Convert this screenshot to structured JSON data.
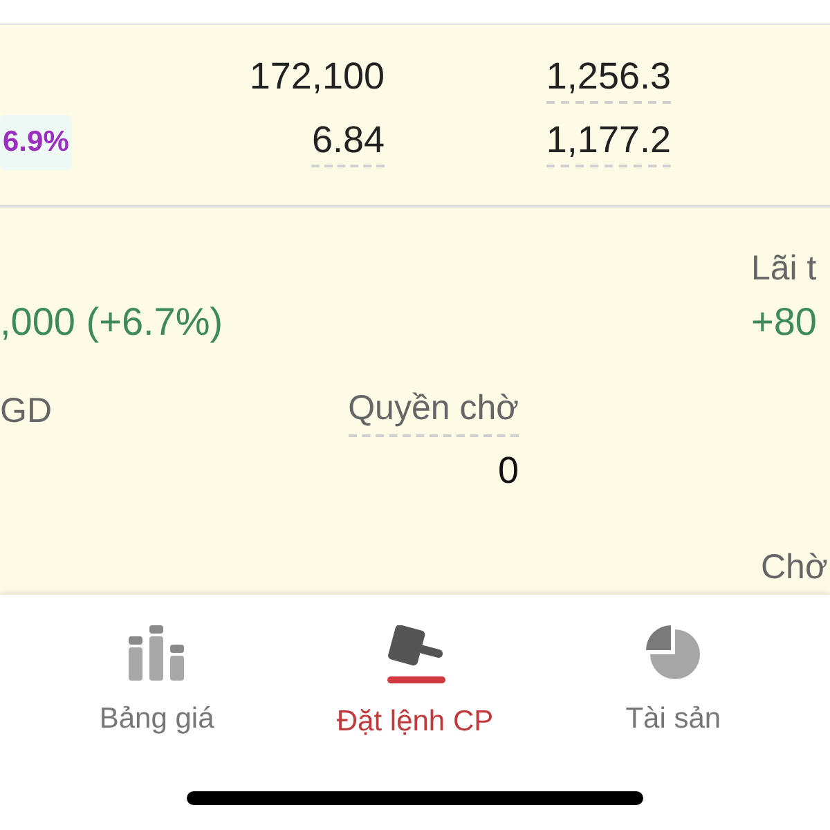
{
  "quote": {
    "badge": "6.9%",
    "rows": [
      {
        "cells": [
          {
            "text": "172,100",
            "dotted": false
          },
          {
            "text": "1,256.3",
            "dotted": true
          }
        ]
      },
      {
        "cells": [
          {
            "text": "6.84",
            "dotted": true
          },
          {
            "text": "1,177.2",
            "dotted": true
          }
        ]
      }
    ]
  },
  "portfolio": {
    "profit_label": "Lãi t",
    "change": ",000 (+6.7%)",
    "profit_value": "+80",
    "column_1_label": "GD",
    "pending_rights_label": "Quyền chờ",
    "pending_rights_value": "0",
    "column_4_label": "Chờ"
  },
  "nav": [
    {
      "label": "Bảng giá",
      "kind": "bars",
      "selected": false
    },
    {
      "label": "Đặt lệnh CP",
      "kind": "gavel",
      "selected": true
    },
    {
      "label": "Tài sản",
      "kind": "pie",
      "selected": false
    }
  ]
}
